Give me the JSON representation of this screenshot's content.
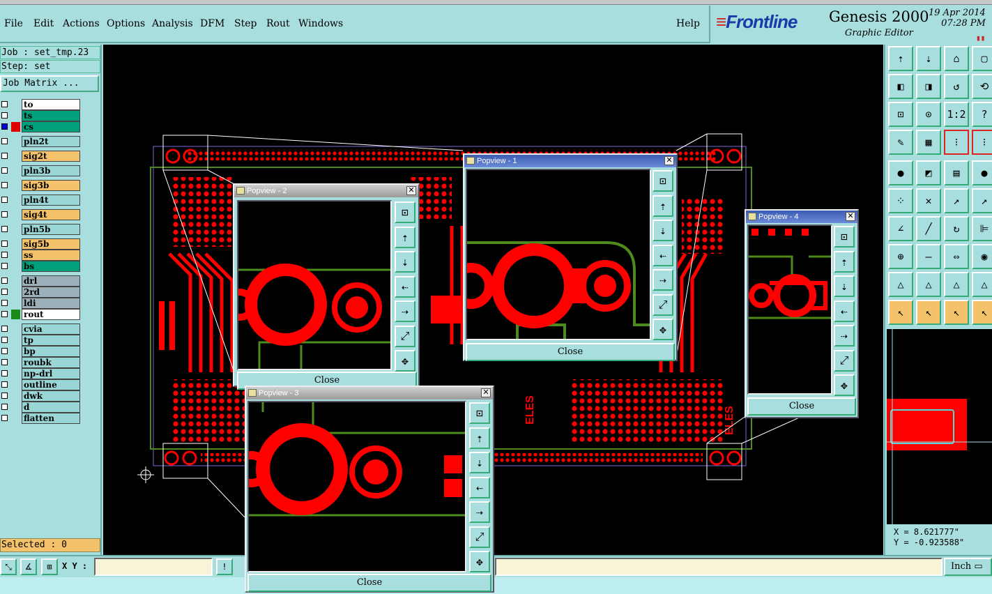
{
  "menu": {
    "items": [
      "File",
      "Edit",
      "Actions",
      "Options",
      "Analysis",
      "DFM",
      "Step",
      "Rout",
      "Windows"
    ],
    "help": "Help"
  },
  "brand": {
    "logo": "Frontline",
    "product": "Genesis 2000",
    "subtitle": "Graphic Editor",
    "date": "19 Apr 2014",
    "time": "07:28 PM"
  },
  "left": {
    "job": "Job : set_tmp.23",
    "step": "Step: set",
    "job_matrix": "Job Matrix ...",
    "layers": [
      {
        "name": "to",
        "color": "#ffffff",
        "chip": "",
        "checked": false
      },
      {
        "name": "ts",
        "color": "#00a07a",
        "chip": "",
        "checked": false
      },
      {
        "name": "cs",
        "color": "#00a07a",
        "chip": "#e00000",
        "checked": true
      },
      {
        "name": "pln2t",
        "color": "#9ad6d6",
        "chip": "",
        "checked": false
      },
      {
        "name": "sig2t",
        "color": "#f4c26a",
        "chip": "",
        "checked": false
      },
      {
        "name": "pln3b",
        "color": "#9ad6d6",
        "chip": "",
        "checked": false
      },
      {
        "name": "sig3b",
        "color": "#f4c26a",
        "chip": "",
        "checked": false
      },
      {
        "name": "pln4t",
        "color": "#9ad6d6",
        "chip": "",
        "checked": false
      },
      {
        "name": "sig4t",
        "color": "#f4c26a",
        "chip": "",
        "checked": false
      },
      {
        "name": "pln5b",
        "color": "#9ad6d6",
        "chip": "",
        "checked": false
      },
      {
        "name": "sig5b",
        "color": "#f4c26a",
        "chip": "",
        "checked": false
      },
      {
        "name": "ss",
        "color": "#f4c26a",
        "chip": "",
        "checked": false
      },
      {
        "name": "bs",
        "color": "#00a07a",
        "chip": "",
        "checked": false
      },
      {
        "name": "drl",
        "color": "#9bb0b8",
        "chip": "",
        "checked": false
      },
      {
        "name": "2rd",
        "color": "#9bb0b8",
        "chip": "",
        "checked": false
      },
      {
        "name": "ldi",
        "color": "#9bb0b8",
        "chip": "",
        "checked": false
      },
      {
        "name": "rout",
        "color": "#ffffff",
        "chip": "#1a8a1a",
        "checked": false
      },
      {
        "name": "cvia",
        "color": "#9ad6d6",
        "chip": "",
        "checked": false
      },
      {
        "name": "tp",
        "color": "#9ad6d6",
        "chip": "",
        "checked": false
      },
      {
        "name": "bp",
        "color": "#9ad6d6",
        "chip": "",
        "checked": false
      },
      {
        "name": "roubk",
        "color": "#9ad6d6",
        "chip": "",
        "checked": false
      },
      {
        "name": "np-drl",
        "color": "#9ad6d6",
        "chip": "",
        "checked": false
      },
      {
        "name": "outline",
        "color": "#9ad6d6",
        "chip": "",
        "checked": false
      },
      {
        "name": "dwk",
        "color": "#9ad6d6",
        "chip": "",
        "checked": false
      },
      {
        "name": "d",
        "color": "#9ad6d6",
        "chip": "",
        "checked": false
      },
      {
        "name": "flatten",
        "color": "#9ad6d6",
        "chip": "",
        "checked": false
      }
    ],
    "selected": "Selected : 0"
  },
  "coords": {
    "x": "X =  8.621777\"",
    "y": "Y = -0.923588\""
  },
  "bottom": {
    "xy_label": "X Y :",
    "xy_value": "",
    "unit": "Inch"
  },
  "popviews": [
    {
      "title": "Popview - 2",
      "close": "Close"
    },
    {
      "title": "Popview - 1",
      "close": "Close"
    },
    {
      "title": "Popview - 3",
      "close": "Close"
    },
    {
      "title": "Popview - 4",
      "close": "Close"
    }
  ],
  "colors": {
    "copper": "#ff0000",
    "rout": "#4e8a1e",
    "panel": "#a9dede",
    "outline": "#ffffff"
  }
}
